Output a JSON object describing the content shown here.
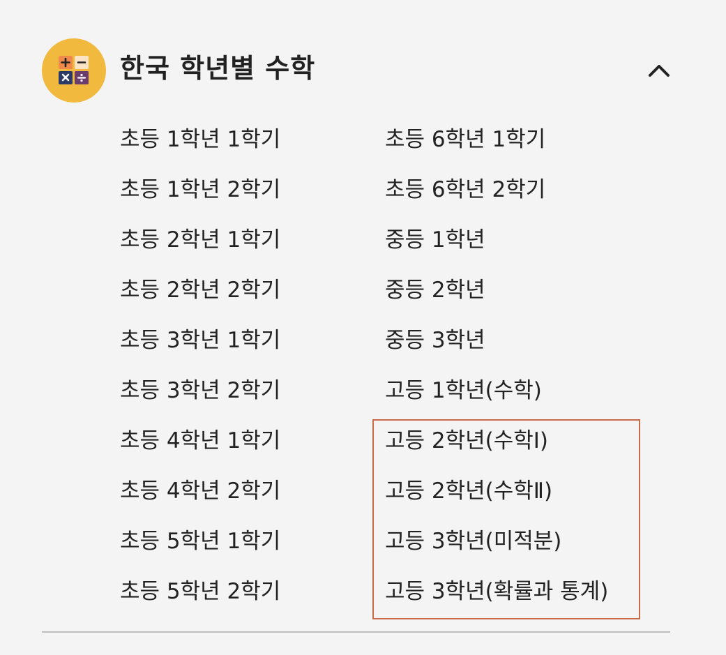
{
  "section": {
    "title": "한국 학년별 수학",
    "icon": "math-operators-icon",
    "expanded": true,
    "badge_color": "#f1b93e",
    "highlight_color": "#c8694a"
  },
  "left_items": [
    "초등 1학년 1학기",
    "초등 1학년 2학기",
    "초등 2학년 1학기",
    "초등 2학년 2학기",
    "초등 3학년 1학기",
    "초등 3학년 2학기",
    "초등 4학년 1학기",
    "초등 4학년 2학기",
    "초등 5학년 1학기",
    "초등 5학년 2학기"
  ],
  "right_items": [
    "초등 6학년 1학기",
    "초등 6학년 2학기",
    "중등 1학년",
    "중등 2학년",
    "중등 3학년",
    "고등 1학년(수학)",
    "고등 2학년(수학Ⅰ)",
    "고등 2학년(수학Ⅱ)",
    "고등 3학년(미적분)",
    "고등 3학년(확률과 통계)"
  ]
}
